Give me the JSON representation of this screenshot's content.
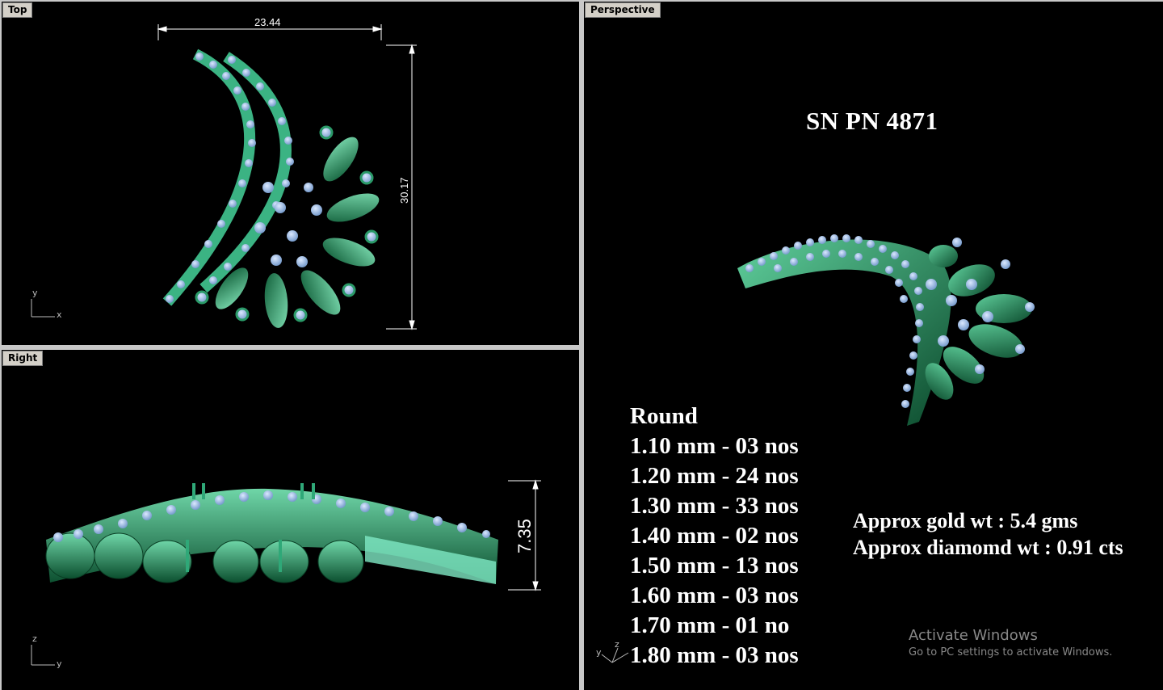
{
  "viewports": {
    "top": {
      "label": "Top",
      "width_dim": "23.44",
      "height_dim": "30.17",
      "axes": [
        "y",
        "x"
      ]
    },
    "right": {
      "label": "Right",
      "height_dim": "7.35",
      "axes": [
        "z",
        "y"
      ]
    },
    "perspective": {
      "label": "Perspective",
      "axes": [
        "y",
        "z"
      ]
    }
  },
  "product": {
    "title": "SN PN 4871"
  },
  "stones": {
    "heading": "Round",
    "rows": [
      "1.10 mm - 03 nos",
      "1.20 mm - 24 nos",
      "1.30 mm - 33 nos",
      "1.40 mm - 02 nos",
      "1.50 mm - 13 nos",
      "1.60 mm - 03 nos",
      "1.70 mm - 01 no",
      "1.80 mm - 03 nos"
    ]
  },
  "weights": {
    "gold": "Approx gold wt : 5.4 gms",
    "diamond": "Approx diamomd wt : 0.91 cts"
  },
  "watermark": {
    "line1": "Activate Windows",
    "line2": "Go to PC settings to activate Windows."
  },
  "colors": {
    "metal": "#1f8a5c",
    "metal_light": "#7fe0b4",
    "stone": "#8fb8e8",
    "viewport_bg": "#000000",
    "tab_bg": "#d4d0c8"
  }
}
